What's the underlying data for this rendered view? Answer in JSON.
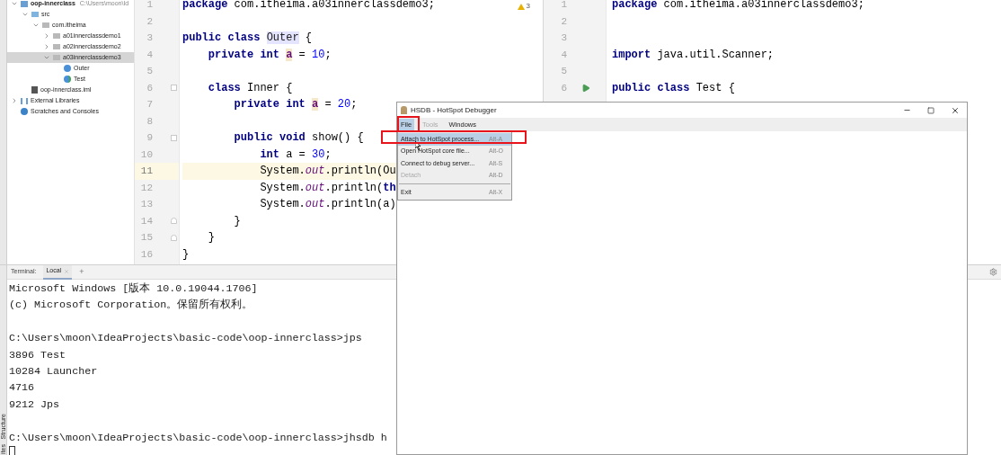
{
  "side_tabs": [
    "Structure",
    "ites"
  ],
  "project_tree": {
    "items": [
      {
        "label": "oop-innerclass",
        "path": "C:\\Users\\moon\\Id",
        "kind": "module",
        "expanded": true,
        "selected": false,
        "children": [
          {
            "label": "src",
            "kind": "source",
            "expanded": true,
            "selected": false,
            "children": [
              {
                "label": "com.itheima",
                "kind": "package",
                "expanded": true,
                "selected": false,
                "children": [
                  {
                    "label": "a01innerclassdemo1",
                    "kind": "package",
                    "expanded": false,
                    "selected": false
                  },
                  {
                    "label": "a02innerclassdemo2",
                    "kind": "package",
                    "expanded": false,
                    "selected": false
                  },
                  {
                    "label": "a03innerclassdemo3",
                    "kind": "package",
                    "expanded": true,
                    "selected": true,
                    "children": [
                      {
                        "label": "Outer",
                        "kind": "class",
                        "selected": false
                      },
                      {
                        "label": "Test",
                        "kind": "main-class",
                        "selected": false
                      }
                    ]
                  }
                ]
              }
            ]
          },
          {
            "label": "oop-innerclass.iml",
            "kind": "file",
            "selected": false
          }
        ]
      },
      {
        "label": "External Libraries",
        "kind": "library",
        "expanded": false,
        "selected": false
      },
      {
        "label": "Scratches and Consoles",
        "kind": "scratch",
        "selected": false
      }
    ]
  },
  "editor_left": {
    "warnings": "3",
    "lines": [
      {
        "number": "1",
        "current": false,
        "tokens": [
          {
            "text": "package ",
            "kind": "keyword"
          },
          {
            "text": "com.itheima.a03innerclassdemo3;",
            "kind": "plain"
          }
        ]
      },
      {
        "number": "2",
        "current": false
      },
      {
        "number": "3",
        "current": false,
        "tokens": [
          {
            "text": "public class ",
            "kind": "keyword"
          },
          {
            "text": "Outer",
            "kind": "usage"
          },
          {
            "text": " {",
            "kind": "plain"
          }
        ]
      },
      {
        "number": "4",
        "current": false,
        "tokens": [
          {
            "text": "    private int ",
            "kind": "keyword"
          },
          {
            "text": "a",
            "kind": "field"
          },
          {
            "text": " = ",
            "kind": "plain"
          },
          {
            "text": "10",
            "kind": "number"
          },
          {
            "text": ";",
            "kind": "plain"
          }
        ]
      },
      {
        "number": "5",
        "current": false
      },
      {
        "number": "6",
        "current": false,
        "kind": "fold-start",
        "tokens": [
          {
            "text": "    class ",
            "kind": "keyword"
          },
          {
            "text": "Inner {",
            "kind": "plain"
          }
        ]
      },
      {
        "number": "7",
        "current": false,
        "tokens": [
          {
            "text": "        private int ",
            "kind": "keyword"
          },
          {
            "text": "a",
            "kind": "field"
          },
          {
            "text": " = ",
            "kind": "plain"
          },
          {
            "text": "20",
            "kind": "number"
          },
          {
            "text": ";",
            "kind": "plain"
          }
        ]
      },
      {
        "number": "8",
        "current": false
      },
      {
        "number": "9",
        "current": false,
        "kind": "fold-start",
        "tokens": [
          {
            "text": "        public void ",
            "kind": "keyword"
          },
          {
            "text": "show() {",
            "kind": "plain"
          }
        ]
      },
      {
        "number": "10",
        "current": false,
        "tokens": [
          {
            "text": "            int ",
            "kind": "keyword"
          },
          {
            "text": "a = ",
            "kind": "plain"
          },
          {
            "text": "30",
            "kind": "number"
          },
          {
            "text": ";",
            "kind": "plain"
          }
        ]
      },
      {
        "number": "11",
        "current": true,
        "tokens": [
          {
            "text": "            System.",
            "kind": "plain"
          },
          {
            "text": "out",
            "kind": "static"
          },
          {
            "text": ".println(Ou",
            "kind": "plain"
          }
        ]
      },
      {
        "number": "12",
        "current": false,
        "tokens": [
          {
            "text": "            System.",
            "kind": "plain"
          },
          {
            "text": "out",
            "kind": "static"
          },
          {
            "text": ".println(",
            "kind": "plain"
          },
          {
            "text": "th",
            "kind": "keyword"
          }
        ]
      },
      {
        "number": "13",
        "current": false,
        "tokens": [
          {
            "text": "            System.",
            "kind": "plain"
          },
          {
            "text": "out",
            "kind": "static"
          },
          {
            "text": ".println(a)",
            "kind": "plain"
          }
        ]
      },
      {
        "number": "14",
        "current": false,
        "kind": "fold-end",
        "tokens": [
          {
            "text": "        }",
            "kind": "plain"
          }
        ]
      },
      {
        "number": "15",
        "current": false,
        "kind": "fold-end",
        "tokens": [
          {
            "text": "    }",
            "kind": "plain"
          }
        ]
      },
      {
        "number": "16",
        "current": false,
        "tokens": [
          {
            "text": "}",
            "kind": "plain"
          }
        ]
      }
    ]
  },
  "editor_right": {
    "lines": [
      {
        "number": "1",
        "run": false,
        "tokens": [
          {
            "text": "package ",
            "kind": "keyword"
          },
          {
            "text": "com.itheima.a03innerclassdemo3;",
            "kind": "plain"
          }
        ]
      },
      {
        "number": "2",
        "run": false
      },
      {
        "number": "3",
        "run": false
      },
      {
        "number": "4",
        "run": false,
        "tokens": [
          {
            "text": "import ",
            "kind": "keyword"
          },
          {
            "text": "java.util.Scanner;",
            "kind": "plain"
          }
        ]
      },
      {
        "number": "5",
        "run": false
      },
      {
        "number": "6",
        "run": true,
        "tokens": [
          {
            "text": "public class ",
            "kind": "keyword"
          },
          {
            "text": "Test {",
            "kind": "plain"
          }
        ]
      }
    ]
  },
  "terminal": {
    "title": "Terminal:",
    "tabs": [
      {
        "label": "Local",
        "selected": true
      }
    ],
    "add": "+",
    "blocks": [
      [
        "Microsoft Windows [版本 10.0.19044.1706]",
        "(c) Microsoft Corporation。保留所有权利。"
      ],
      [
        "C:\\Users\\moon\\IdeaProjects\\basic-code\\oop-innerclass>jps",
        "3896 Test",
        "10284 Launcher",
        "4716",
        "9212 Jps"
      ],
      [
        "C:\\Users\\moon\\IdeaProjects\\basic-code\\oop-innerclass>jhsdb h"
      ]
    ]
  },
  "hsdb_window": {
    "title": "HSDB - HotSpot Debugger",
    "menus": [
      {
        "label": "File",
        "selected": true,
        "disabled": false
      },
      {
        "label": "Tools",
        "selected": false,
        "disabled": true
      },
      {
        "label": "Windows",
        "selected": false,
        "disabled": false
      }
    ],
    "menu_items": [
      {
        "kind": "item",
        "label": "Attach to HotSpot process...",
        "shortcut": "Alt-A",
        "selected": true,
        "disabled": false
      },
      {
        "kind": "item",
        "label": "Open HotSpot core file...",
        "shortcut": "Alt-O",
        "selected": false,
        "disabled": false
      },
      {
        "kind": "item",
        "label": "Connect to debug server...",
        "shortcut": "Alt-S",
        "selected": false,
        "disabled": false
      },
      {
        "kind": "item",
        "label": "Detach",
        "shortcut": "Alt-D",
        "selected": false,
        "disabled": true
      },
      {
        "kind": "separator"
      },
      {
        "kind": "item",
        "label": "Exit",
        "shortcut": "Alt-X",
        "selected": false,
        "disabled": false
      }
    ]
  }
}
